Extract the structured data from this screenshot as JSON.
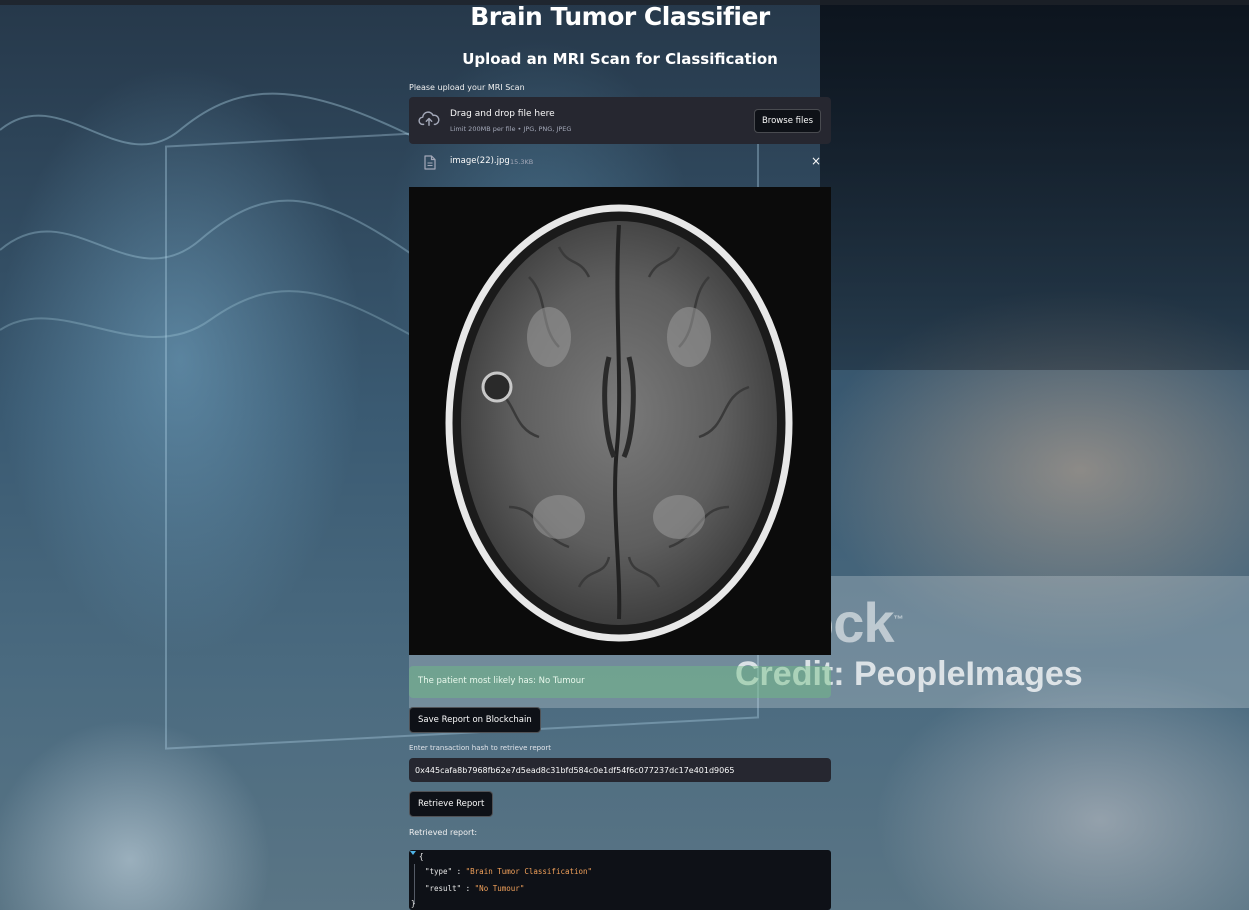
{
  "app": {
    "title": "Brain Tumor Classifier",
    "subtitle": "Upload an MRI Scan for Classification"
  },
  "uploader": {
    "label": "Please upload your MRI Scan",
    "drop_text": "Drag and drop file here",
    "limit_text": "Limit 200MB per file • JPG, PNG, JPEG",
    "browse_label": "Browse files",
    "file": {
      "name": "image(22).jpg",
      "size": "15.3KB",
      "remove_label": "×"
    }
  },
  "image": {
    "icon": "mri-brain-scan"
  },
  "result": {
    "text": "The patient most likely has: No Tumour"
  },
  "blockchain": {
    "save_label": "Save Report on Blockchain",
    "hash_label": "Enter transaction hash to retrieve report",
    "hash_value": "0x445cafa8b7968fb62e7d5ead8c31bfd584c0e1df54f6c077237dc17e401d9065",
    "retrieve_label": "Retrieve Report",
    "retrieved_label": "Retrieved report:"
  },
  "report_json": {
    "open_brace": "{",
    "close_brace": "}",
    "type_key": "\"type\"",
    "type_value": "\"Brain Tumor Classification\"",
    "result_key": "\"result\"",
    "result_value": "\"No Tumour\"",
    "separator": ":"
  },
  "watermark": {
    "logo": "ock",
    "credit": "Credit: PeopleImages",
    "tm": "™"
  },
  "colors": {
    "panel": "#262730",
    "button_bg": "#0e1117",
    "success": "#6ebe82",
    "json_string": "#f0a05a"
  }
}
